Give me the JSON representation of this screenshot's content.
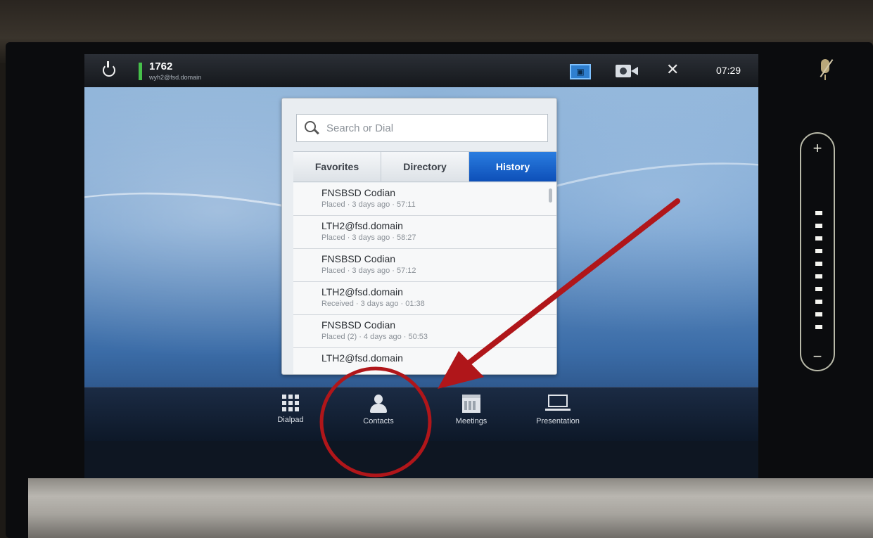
{
  "status_bar": {
    "extension": "1762",
    "sip_uri": "wyh2@fsd.domain",
    "time": "07:29"
  },
  "search": {
    "placeholder": "Search or Dial"
  },
  "tabs": [
    {
      "label": "Favorites",
      "active": false
    },
    {
      "label": "Directory",
      "active": false
    },
    {
      "label": "History",
      "active": true
    }
  ],
  "history": [
    {
      "name": "FNSBSD Codian",
      "detail": "Placed · 3 days ago · 57:11"
    },
    {
      "name": "LTH2@fsd.domain",
      "detail": "Placed · 3 days ago · 58:27"
    },
    {
      "name": "FNSBSD Codian",
      "detail": "Placed · 3 days ago · 57:12"
    },
    {
      "name": "LTH2@fsd.domain",
      "detail": "Received · 3 days ago · 01:38"
    },
    {
      "name": "FNSBSD Codian",
      "detail": "Placed (2) · 4 days ago · 50:53"
    },
    {
      "name": "LTH2@fsd.domain",
      "detail": ""
    }
  ],
  "launcher": {
    "dialpad": "Dialpad",
    "contacts": "Contacts",
    "meetings": "Meetings",
    "presentation": "Presentation"
  },
  "volume": {
    "plus": "+",
    "minus": "−",
    "level_segments": 10
  },
  "colors": {
    "accent_tab": "#1565d0",
    "annotation": "#b0161a",
    "signal": "#46c04a"
  }
}
